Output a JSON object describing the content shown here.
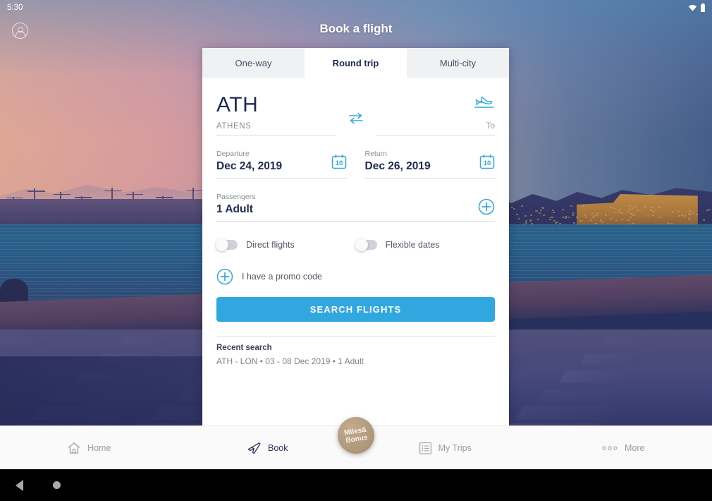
{
  "status_bar": {
    "time": "5:30",
    "wifi_icon": "wifi-icon",
    "battery_icon": "battery-icon"
  },
  "header": {
    "title": "Book a flight",
    "account_icon": "account-circle-icon"
  },
  "tabs": [
    {
      "label": "One-way",
      "active": false
    },
    {
      "label": "Round trip",
      "active": true
    },
    {
      "label": "Multi-city",
      "active": false
    }
  ],
  "route": {
    "origin_code": "ATH",
    "origin_city": "ATHENS",
    "swap_icon": "swap-arrows-icon",
    "destination_icon": "plane-landing-icon",
    "destination_placeholder": "To"
  },
  "dates": {
    "departure_label": "Departure",
    "departure_value": "Dec 24, 2019",
    "departure_icon": "calendar-icon",
    "departure_icon_day": "10",
    "return_label": "Return",
    "return_value": "Dec 26, 2019",
    "return_icon": "calendar-icon",
    "return_icon_day": "10"
  },
  "passengers": {
    "label": "Passengers",
    "value": "1 Adult",
    "add_icon": "plus-circle-icon"
  },
  "options": [
    {
      "label": "Direct flights",
      "on": false
    },
    {
      "label": "Flexible dates",
      "on": false
    }
  ],
  "promo": {
    "label": "I have a promo code",
    "icon": "plus-circle-icon"
  },
  "search_button": {
    "label": "SEARCH FLIGHTS",
    "color": "#31a7e0"
  },
  "recent_search": {
    "title": "Recent search",
    "value": "ATH - LON • 03 - 08 Dec 2019 • 1 Adult"
  },
  "bottom_nav": {
    "items": [
      {
        "label": "Home",
        "icon": "home-icon",
        "active": false
      },
      {
        "label": "Book",
        "icon": "plane-icon",
        "active": true
      },
      {
        "label": "My Trips",
        "icon": "list-icon",
        "active": false
      },
      {
        "label": "More",
        "icon": "ellipsis-icon",
        "active": false
      }
    ],
    "badge": {
      "line1": "Miles&",
      "line2": "Bonus",
      "color": "#ad9679"
    }
  },
  "android_nav": {
    "back_icon": "back-triangle-icon",
    "home_icon": "home-circle-icon"
  },
  "colors": {
    "accent": "#31a7e0",
    "navy": "#1d2a52",
    "card_bg": "#ffffff"
  }
}
